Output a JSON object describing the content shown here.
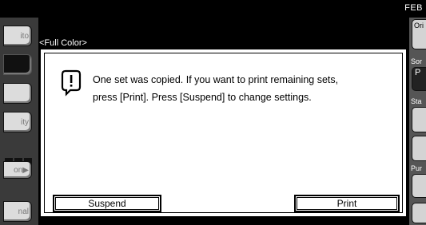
{
  "header": {
    "month": "FEB"
  },
  "screen": {
    "mode_label": "<Full Color>"
  },
  "left_panel": {
    "buttons": [
      "ito",
      "",
      "",
      "ity",
      "on▶",
      "nal"
    ]
  },
  "right_panel": {
    "labels": [
      "Ori",
      "Sor",
      "Sta",
      "Pur"
    ],
    "sort_button": "P"
  },
  "dialog": {
    "icon": "warning-icon",
    "line1": "One set was copied. If you want to print remaining sets,",
    "line2": "press [Print]. Press [Suspend] to change settings.",
    "suspend_label": "Suspend",
    "print_label": "Print"
  },
  "colors": {
    "background": "#000000",
    "dialog": "#ffffff",
    "panel": "#dcdcdc"
  }
}
